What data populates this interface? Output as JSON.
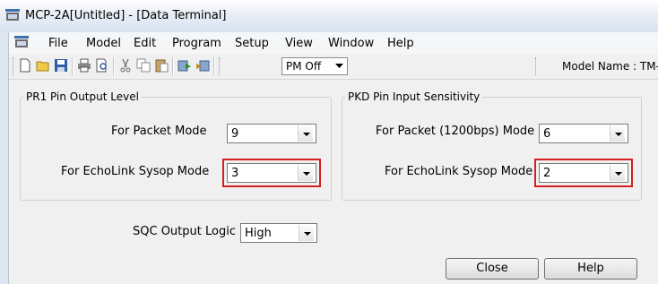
{
  "window": {
    "title": "MCP-2A[Untitled] - [Data Terminal]"
  },
  "menu": [
    "File",
    "Model",
    "Edit",
    "Program",
    "Setup",
    "View",
    "Window",
    "Help"
  ],
  "toolbar": {
    "pm_combo_value": "PM Off",
    "model_name_label": "Model Name : TM-"
  },
  "pr1_group": {
    "title": "PR1 Pin Output Level",
    "packet_label": "For Packet Mode",
    "packet_value": "9",
    "echolink_label": "For EchoLink Sysop Mode",
    "echolink_value": "3"
  },
  "pkd_group": {
    "title": "PKD Pin Input Sensitivity",
    "packet_label": "For Packet (1200bps) Mode",
    "packet_value": "6",
    "echolink_label": "For EchoLink Sysop Mode",
    "echolink_value": "2"
  },
  "sqc": {
    "label": "SQC Output Logic",
    "value": "High"
  },
  "buttons": {
    "close": "Close",
    "help": "Help"
  },
  "colors": {
    "highlight": "#d21f1f"
  }
}
